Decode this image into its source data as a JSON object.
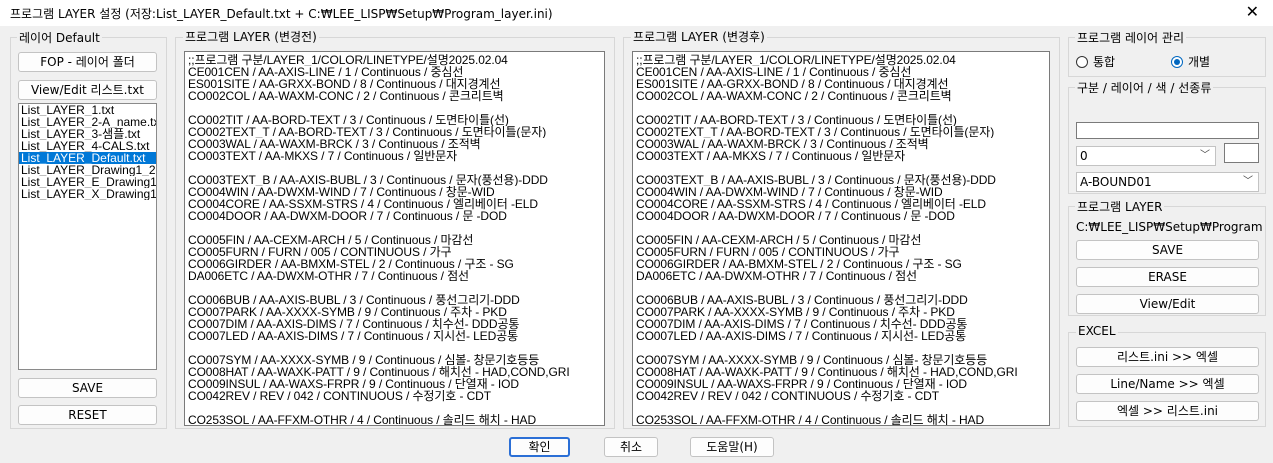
{
  "window": {
    "title": "프로그램 LAYER 설정 (저장:List_LAYER_Default.txt + C:₩LEE_LISP₩Setup₩Program_layer.ini)",
    "close_label": "✕"
  },
  "left_panel": {
    "title": "레이어 Default",
    "fop_button": "FOP - 레이어 폴더",
    "view_edit_button": "View/Edit 리스트.txt",
    "files": [
      "List_LAYER_1.txt",
      "List_LAYER_2-A_name.txt",
      "List_LAYER_3-샘플.txt",
      "List_LAYER_4-CALS.txt",
      "List_LAYER_Default.txt",
      "List_LAYER_Drawing1_2",
      "List_LAYER_E_Drawing1",
      "List_LAYER_X_Drawing1"
    ],
    "selected_index": 4,
    "save_button": "SAVE",
    "reset_button": "RESET"
  },
  "before_panel": {
    "title": "프로그램 LAYER (변경전)",
    "lines": [
      ";;프로그램 구분/LAYER_1/COLOR/LINETYPE/설명2025.02.04",
      "CE001CEN / AA-AXIS-LINE / 1 / Continuous / 중심선",
      "ES001SITE / AA-GRXX-BOND / 8 / Continuous / 대지경계선",
      "CO002COL / AA-WAXM-CONC / 2 / Continuous / 콘크리트벽",
      "",
      "CO002TIT / AA-BORD-TEXT / 3 / Continuous / 도면타이틀(선)",
      "CO002TEXT_T / AA-BORD-TEXT / 3 / Continuous / 도면타이틀(문자)",
      "CO003WAL / AA-WAXM-BRCK / 3 / Continuous / 조적벽",
      "CO003TEXT / AA-MKXS / 7 / Continuous / 일반문자",
      "",
      "CO003TEXT_B / AA-AXIS-BUBL / 3 / Continuous / 문자(풍선용)-DDD",
      "CO004WIN / AA-DWXM-WIND / 7 / Continuous / 창문-WID",
      "CO004CORE / AA-SSXM-STRS / 4 / Continuous / 엘리베이터 -ELD",
      "CO004DOOR / AA-DWXM-DOOR / 7 / Continuous / 문 -DOD",
      "",
      "CO005FIN / AA-CEXM-ARCH / 5 / Continuous / 마감선",
      "CO005FURN / FURN / 005 / CONTINUOUS / 가구",
      "CO006GIRDER / AA-BMXM-STEL / 2 / Continuous / 구조 - SG",
      "DA006ETC / AA-DWXM-OTHR / 7 / Continuous / 점선",
      "",
      "CO006BUB / AA-AXIS-BUBL / 3 / Continuous / 풍선그리기-DDD",
      "CO007PARK / AA-XXXX-SYMB / 9 / Continuous / 주차 - PKD",
      "CO007DIM / AA-AXIS-DIMS / 7 / Continuous / 치수선- DDD공통",
      "CO007LED / AA-AXIS-DIMS / 7 / Continuous / 지시선- LED공통",
      "",
      "CO007SYM / AA-XXXX-SYMB / 9 / Continuous / 심볼- 창문기호등등",
      "CO008HAT / AA-WAXK-PATT / 9 / Continuous / 해치선 - HAD,COND,GRI",
      "CO009INSUL / AA-WAXS-FRPR / 9 / Continuous / 단열재 - IOD",
      "CO042REV / REV / 042 / CONTINUOUS / 수정기호 - CDT",
      "",
      "CO253SOL / AA-FFXM-OTHR / 4 / Continuous / 솔리드 해치 - HAD"
    ]
  },
  "after_panel": {
    "title": "프로그램 LAYER (변경후)",
    "lines": [
      ";;프로그램 구분/LAYER_1/COLOR/LINETYPE/설명2025.02.04",
      "CE001CEN / AA-AXIS-LINE / 1 / Continuous / 중심선",
      "ES001SITE / AA-GRXX-BOND / 8 / Continuous / 대지경계선",
      "CO002COL / AA-WAXM-CONC / 2 / Continuous / 콘크리트벽",
      "",
      "CO002TIT / AA-BORD-TEXT / 3 / Continuous / 도면타이틀(선)",
      "CO002TEXT_T / AA-BORD-TEXT / 3 / Continuous / 도면타이틀(문자)",
      "CO003WAL / AA-WAXM-BRCK / 3 / Continuous / 조적벽",
      "CO003TEXT / AA-MKXS / 7 / Continuous / 일반문자",
      "",
      "CO003TEXT_B / AA-AXIS-BUBL / 3 / Continuous / 문자(풍선용)-DDD",
      "CO004WIN / AA-DWXM-WIND / 7 / Continuous / 창문-WID",
      "CO004CORE / AA-SSXM-STRS / 4 / Continuous / 엘리베이터 -ELD",
      "CO004DOOR / AA-DWXM-DOOR / 7 / Continuous / 문 -DOD",
      "",
      "CO005FIN / AA-CEXM-ARCH / 5 / Continuous / 마감선",
      "CO005FURN / FURN / 005 / CONTINUOUS / 가구",
      "CO006GIRDER / AA-BMXM-STEL / 2 / Continuous / 구조 - SG",
      "DA006ETC / AA-DWXM-OTHR / 7 / Continuous / 점선",
      "",
      "CO006BUB / AA-AXIS-BUBL / 3 / Continuous / 풍선그리기-DDD",
      "CO007PARK / AA-XXXX-SYMB / 9 / Continuous / 주차 - PKD",
      "CO007DIM / AA-AXIS-DIMS / 7 / Continuous / 치수선- DDD공통",
      "CO007LED / AA-AXIS-DIMS / 7 / Continuous / 지시선- LED공통",
      "",
      "CO007SYM / AA-XXXX-SYMB / 9 / Continuous / 심볼- 창문기호등등",
      "CO008HAT / AA-WAXK-PATT / 9 / Continuous / 해치선 - HAD,COND,GRI",
      "CO009INSUL / AA-WAXS-FRPR / 9 / Continuous / 단열재 - IOD",
      "CO042REV / REV / 042 / CONTINUOUS / 수정기호 - CDT",
      "",
      "CO253SOL / AA-FFXM-OTHR / 4 / Continuous / 솔리드 해치 - HAD"
    ]
  },
  "right_panel": {
    "manage_title": "프로그램 레이어 관리",
    "radio_integrated": "통합",
    "radio_individual": "개별",
    "selected_radio": "개별",
    "fields_title": "구분 / 레이어 / 색 / 선종류",
    "color_combo_value": "0",
    "layer_combo_value": "A-BOUND01",
    "program_layer_title": "프로그램 LAYER",
    "program_path": "C:₩LEE_LISP₩Setup₩Program_layer.ini",
    "save_button": "SAVE",
    "erase_button": "ERASE",
    "view_edit_button": "View/Edit",
    "excel_title": "EXCEL",
    "excel_btn1": "리스트.ini >> 엑셀",
    "excel_btn2": "Line/Name >> 엑셀",
    "excel_btn3": "엑셀 >> 리스트.ini"
  },
  "footer": {
    "ok_button": "확인",
    "cancel_button": "취소",
    "help_button": "도움말(H)"
  },
  "colors": {
    "selection": "#0078d7",
    "default_button_border": "#2b6fd6",
    "radio_accent": "#0067c0"
  }
}
